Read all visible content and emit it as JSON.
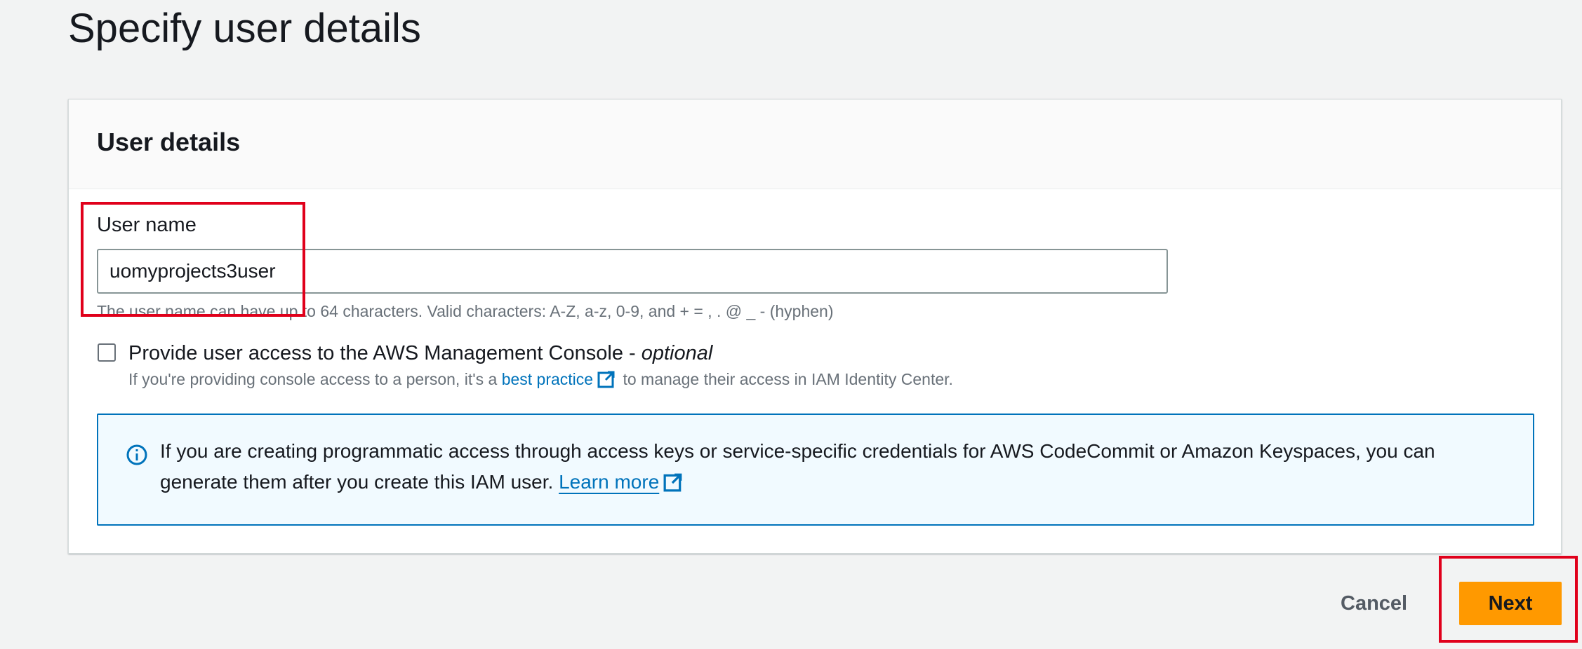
{
  "page": {
    "title": "Specify user details"
  },
  "user_details": {
    "heading": "User details",
    "username_label": "User name",
    "username_value": "uomyprojects3user",
    "username_constraint": "The user name can have up to 64 characters. Valid characters: A-Z, a-z, 0-9, and + = , . @ _ - (hyphen)",
    "console_access": {
      "checked": false,
      "label": "Provide user access to the AWS Management Console - ",
      "label_suffix": "optional",
      "desc_prefix": "If you're providing console access to a person, it's a ",
      "desc_link": "best practice",
      "desc_suffix": " to manage their access in IAM Identity Center."
    },
    "info": {
      "text": "If you are creating programmatic access through access keys or service-specific credentials for AWS CodeCommit or Amazon Keyspaces, you can generate them after you create this IAM user. ",
      "link": "Learn more"
    }
  },
  "actions": {
    "cancel_label": "Cancel",
    "next_label": "Next"
  },
  "colors": {
    "accent": "#ff9900",
    "link": "#0073bb",
    "info_bg": "#f1faff",
    "highlight": "#e0001b"
  },
  "icons": [
    "external-link-icon",
    "info-icon"
  ]
}
